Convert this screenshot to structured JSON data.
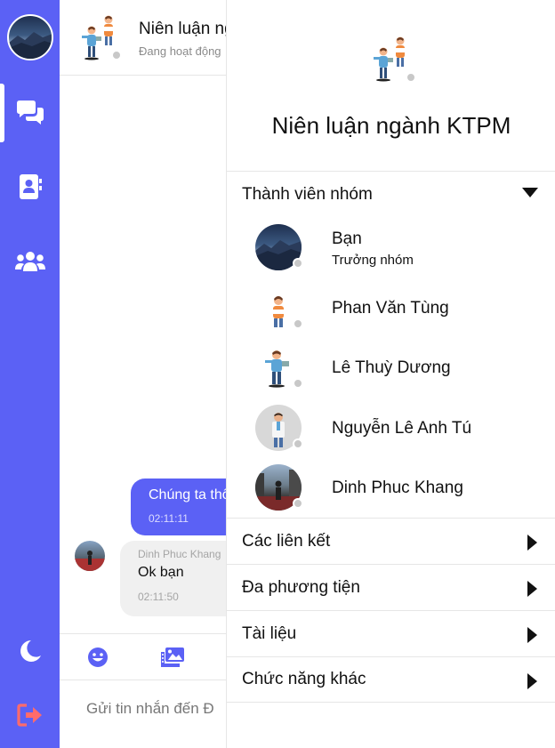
{
  "sidebar": {
    "items": [
      {
        "name": "chat-icon"
      },
      {
        "name": "contacts-icon"
      },
      {
        "name": "groups-icon"
      },
      {
        "name": "dark-mode-icon"
      },
      {
        "name": "logout-icon"
      }
    ],
    "accent": "#5b61f5",
    "logout_color": "#ff6b6b"
  },
  "chat": {
    "title": "Niên luận ngành KTPM",
    "status": "Đang hoạt động",
    "messages": [
      {
        "direction": "out",
        "text": "Chúng ta thống nhất nhé",
        "time": "02:11:11"
      },
      {
        "direction": "in",
        "sender": "Dinh Phuc Khang",
        "text": "Ok bạn",
        "time": "02:11:50"
      }
    ],
    "toolbar": {
      "emoji": "emoji-icon",
      "media": "image-gallery-icon"
    },
    "input_placeholder": "Gửi tin nhắn đến Đ"
  },
  "panel": {
    "group_name": "Niên luận ngành KTPM",
    "members_header": "Thành viên nhóm",
    "members": [
      {
        "name": "Bạn",
        "role": "Trưởng nhóm"
      },
      {
        "name": "Phan Văn Tùng",
        "role": ""
      },
      {
        "name": "Lê Thuỳ Dương",
        "role": ""
      },
      {
        "name": "Nguyễn Lê Anh Tú",
        "role": ""
      },
      {
        "name": "Dinh Phuc Khang",
        "role": ""
      }
    ],
    "sections": [
      {
        "label": "Các liên kết"
      },
      {
        "label": "Đa phương tiện"
      },
      {
        "label": "Tài liệu"
      },
      {
        "label": "Chức năng khác"
      }
    ]
  }
}
